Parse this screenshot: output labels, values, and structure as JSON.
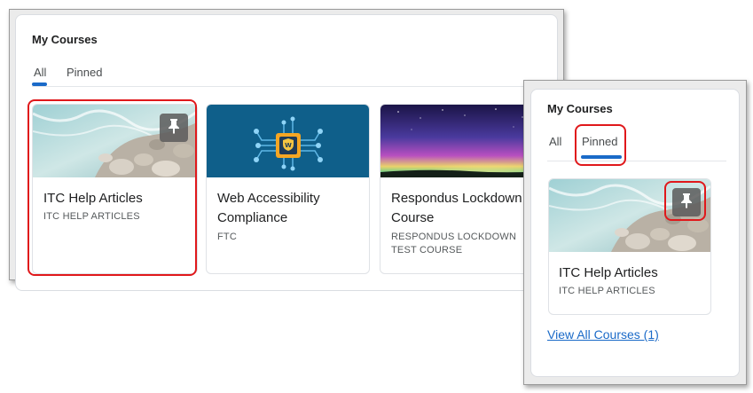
{
  "left_panel": {
    "heading": "My Courses",
    "tabs": [
      {
        "label": "All",
        "selected": true
      },
      {
        "label": "Pinned",
        "selected": false
      }
    ],
    "courses": [
      {
        "title": "ITC Help Articles",
        "code": "ITC HELP ARTICLES",
        "image": "ocean-rocks-image",
        "pinned": true
      },
      {
        "title": "Web Accessibility Compliance",
        "code": "FTC",
        "image": "accessibility-circuit-image",
        "pinned": false
      },
      {
        "title": "Respondus Lockdown Test Course",
        "code": "RESPONDUS LOCKDOWN TEST COURSE",
        "image": "aurora-night-sky-image",
        "pinned": false
      }
    ]
  },
  "right_panel": {
    "heading": "My Courses",
    "tabs": [
      {
        "label": "All",
        "selected": false
      },
      {
        "label": "Pinned",
        "selected": true
      }
    ],
    "courses": [
      {
        "title": "ITC Help Articles",
        "code": "ITC HELP ARTICLES",
        "image": "ocean-rocks-image",
        "pinned": true
      }
    ],
    "view_all_link": "View All Courses (1)"
  },
  "icons": {
    "pin": "pin-icon",
    "shield": "shield-w-icon"
  },
  "colors": {
    "accent": "#1a6ac8",
    "highlight": "#e0181b",
    "accessibility_bg": "#0f5f8a"
  }
}
